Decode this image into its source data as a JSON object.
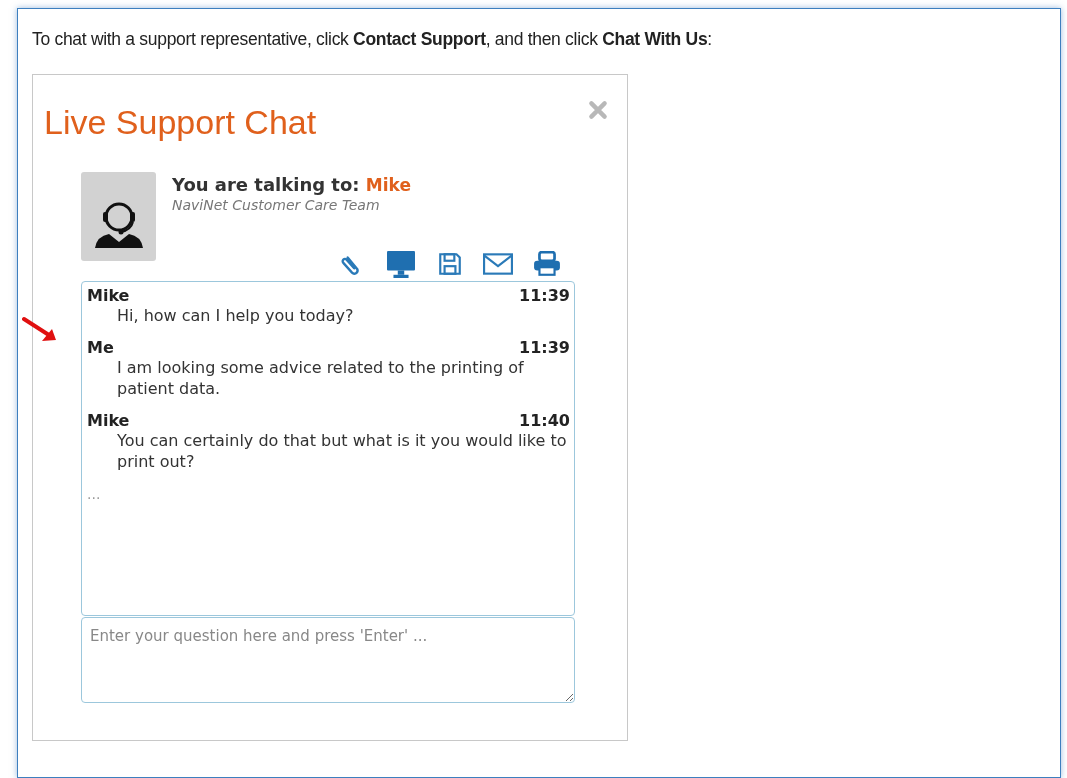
{
  "instruction": "To chat with a support representative, click **Contact Support**, and then click **Chat With Us**:",
  "chat": {
    "title": "Live Support Chat",
    "talking_to_label": "You are talking to:",
    "agent_name": "Mike",
    "team": "NaviNet Customer Care Team",
    "messages": [
      {
        "sender": "Mike",
        "time": "11:39",
        "text": "Hi, how can I help you today?"
      },
      {
        "sender": "Me",
        "time": "11:39",
        "text": "I am looking some advice related to the printing of patient data."
      },
      {
        "sender": "Mike",
        "time": "11:40",
        "text": "You can certainly do that but what is it you would like to print out?"
      }
    ],
    "typing_indicator": "...",
    "input": {
      "placeholder": "Enter your question here and press 'Enter' ..."
    }
  }
}
